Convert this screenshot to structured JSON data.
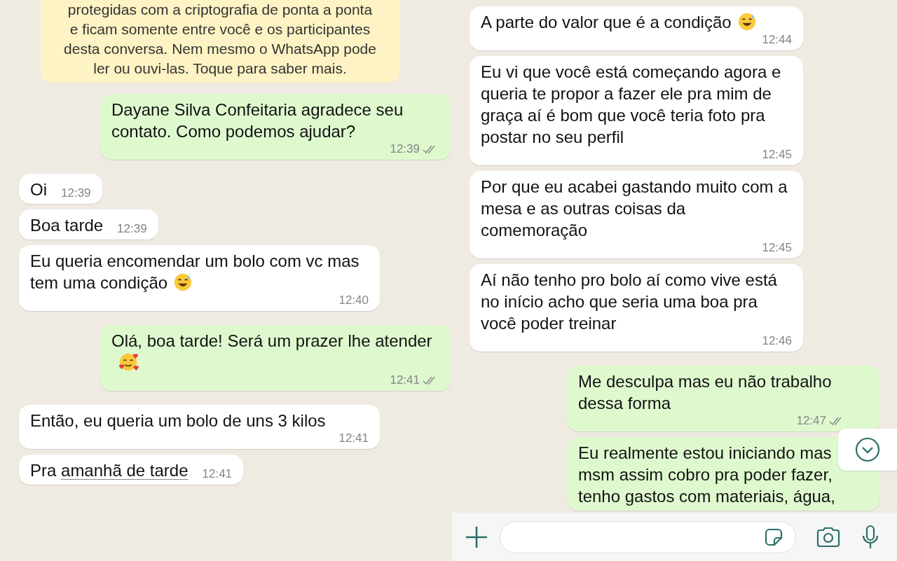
{
  "left_chat": {
    "encryption_notice": [
      "protegidas com a criptografia de ponta a ponta",
      "e ficam somente entre você e os participantes",
      "desta conversa. Nem mesmo o WhatsApp pode",
      "ler ou ouvi-las. Toque para saber mais."
    ],
    "messages": [
      {
        "kind": "outgoing",
        "text": "Dayane Silva Confeitaria agradece seu contato. Como podemos ajudar?",
        "time": "12:39",
        "read": false
      },
      {
        "kind": "incoming",
        "text": "Oi",
        "time": "12:39"
      },
      {
        "kind": "incoming",
        "text": "Boa tarde",
        "time": "12:39"
      },
      {
        "kind": "incoming",
        "text": "Eu queria encomendar um bolo com vc mas tem  uma condição",
        "emoji": {
          "kind": "sweat_smile"
        },
        "time": "12:40"
      },
      {
        "kind": "outgoing",
        "text": "Olá, boa tarde! Será um prazer lhe atender",
        "emoji": {
          "kind": "smiling_hearts"
        },
        "time": "12:41",
        "read": false
      },
      {
        "kind": "incoming",
        "text": "Então, eu queria um bolo de uns 3 kilos",
        "time": "12:41"
      },
      {
        "kind": "incoming",
        "text": "Pra",
        "link": "amanhã de tarde",
        "time": "12:41"
      }
    ]
  },
  "right_chat": {
    "messages": [
      {
        "kind": "incoming",
        "text": "A parte do valor que é a condição",
        "emoji": {
          "kind": "sweat_smile"
        },
        "time": "12:44"
      },
      {
        "kind": "incoming",
        "text": "Eu vi que você está começando agora e queria te propor a fazer ele pra mim de graça aí é bom que você teria foto pra postar no seu perfil",
        "time": "12:45"
      },
      {
        "kind": "incoming",
        "text": "Por que eu acabei gastando muito com a mesa e as outras coisas da comemoração",
        "time": "12:45"
      },
      {
        "kind": "incoming",
        "text": "Aí não tenho pro bolo aí como vive está no início acho que seria uma boa pra você poder treinar",
        "time": "12:46"
      },
      {
        "kind": "outgoing",
        "text": "Me desculpa mas eu não trabalho dessa forma",
        "time": "12:47",
        "read": false
      },
      {
        "kind": "outgoing",
        "text": "Eu realmente estou iniciando mas msm assim cobro pra poder fazer, tenho gastos com materiais, água,"
      }
    ]
  }
}
